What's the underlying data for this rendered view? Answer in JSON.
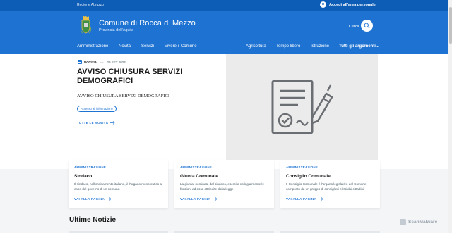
{
  "topbar": {
    "region": "Regione Abruzzo",
    "login": "Accedi all'area personale"
  },
  "header": {
    "title": "Comune di Rocca di Mezzo",
    "subtitle": "Provincia dell'Aquila",
    "search_label": "Cerca"
  },
  "nav": {
    "left": [
      "Amministrazione",
      "Novità",
      "Servizi",
      "Vivere il Comune"
    ],
    "right": [
      "Agricoltura",
      "Tempo libero",
      "Istruzione"
    ],
    "all": "Tutti gli argomenti..."
  },
  "hero": {
    "type": "NOTIZIA",
    "date": "29 SET 2023",
    "title": "AVVISO CHIUSURA SERVIZI DEMOGRAFICI",
    "description": "AVVISO CHIUSURA SERVIZI DEMOGRAFICI",
    "tag": "Accesso all'informazione",
    "link": "TUTTE LE NOVITÀ"
  },
  "cards": [
    {
      "category": "AMMINISTRAZIONE",
      "title": "Sindaco",
      "text": "Il sindaco, nell'ordinamento italiano, è l'organo monocratico a capo del governo di un comune.",
      "link": "VAI ALLA PAGINA"
    },
    {
      "category": "AMMINISTRAZIONE",
      "title": "Giunta Comunale",
      "text": "La giunta, nominata dal sindaco, esercita collegialmente le funzioni ad essa attribuite dalla legge.",
      "link": "VAI ALLA PAGINA"
    },
    {
      "category": "AMMINISTRAZIONE",
      "title": "Consiglio Comunale",
      "text": "Il Consiglio Comunale è l'organo legislativo del Comune, composto da un gruppo di consiglieri eletti dai cittadini.",
      "link": "VAI ALLA PAGINA"
    }
  ],
  "latest_news_title": "Ultime Notizie",
  "watermark": "ScanMalware",
  "colors": {
    "primary": "#1e73d2",
    "topbar": "#0d5cb5",
    "band": "#f3f5f7"
  }
}
